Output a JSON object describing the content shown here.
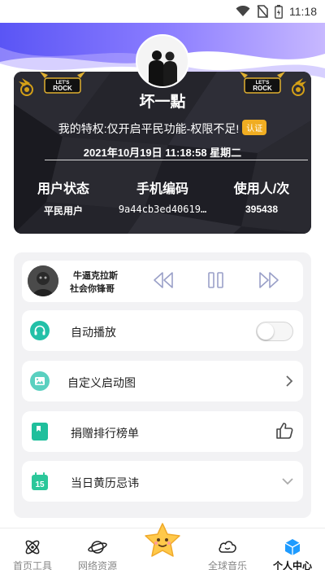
{
  "statusbar": {
    "time": "11:18"
  },
  "profile": {
    "username": "坏一點",
    "privilege_text": "我的特权:仅开启平民功能-权限不足!",
    "auth_badge": "认证",
    "datetime": "2021年10月19日 11:18:58 星期二",
    "stats": [
      {
        "label": "用户状态",
        "value": "平民用户"
      },
      {
        "label": "手机编码",
        "value": "9a44cb3ed40619…"
      },
      {
        "label": "使用人/次",
        "value": "395438"
      }
    ],
    "logo_text": "LET'S ROCK"
  },
  "player": {
    "title": "牛逼克拉斯",
    "artist": "社会你锋哥"
  },
  "settings": {
    "autoplay_label": "自动播放",
    "autoplay_on": false,
    "splash_label": "自定义启动图",
    "donation_label": "捐赠排行榜单",
    "almanac_label": "当日黄历忌讳",
    "calendar_day": "15"
  },
  "tabbar": {
    "tabs": [
      {
        "label": "首页工具",
        "active": false
      },
      {
        "label": "网络资源",
        "active": false
      },
      {
        "label": "",
        "active": false
      },
      {
        "label": "全球音乐",
        "active": false
      },
      {
        "label": "个人中心",
        "active": true
      }
    ]
  },
  "colors": {
    "accent_purple": "#6b5cff",
    "badge_orange": "#f0ad22",
    "teal_icon": "#2ec4a6",
    "blue_tab": "#1e9bff"
  }
}
